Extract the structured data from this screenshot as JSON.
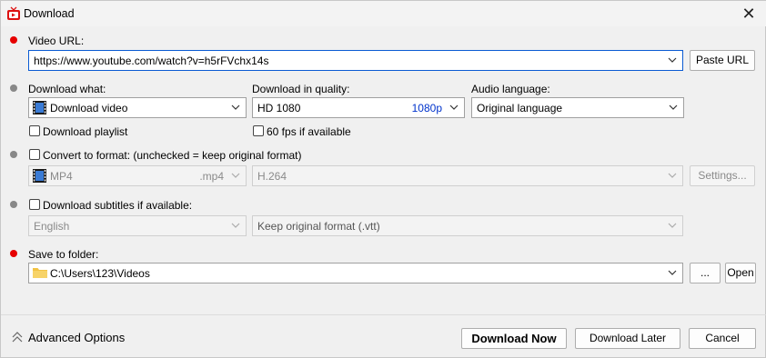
{
  "window": {
    "title": "Download"
  },
  "video_url": {
    "label": "Video URL:",
    "value": "https://www.youtube.com/watch?v=h5rFVchx14s",
    "paste_button": "Paste URL"
  },
  "download_what": {
    "label": "Download what:",
    "value": "Download video",
    "playlist_label": "Download playlist"
  },
  "quality": {
    "label": "Download in quality:",
    "value": "HD 1080",
    "badge": "1080p",
    "fps_label": "60 fps if available"
  },
  "audio": {
    "label": "Audio language:",
    "value": "Original language"
  },
  "convert": {
    "label": "Convert to format: (unchecked = keep original format)",
    "format": "MP4",
    "ext": ".mp4",
    "codec": "H.264",
    "settings_button": "Settings..."
  },
  "subtitles": {
    "label": "Download subtitles if available:",
    "language": "English",
    "format": "Keep original format (.vtt)"
  },
  "folder": {
    "label": "Save to folder:",
    "path": "C:\\Users\\123\\Videos",
    "browse_button": "...",
    "open_button": "Open"
  },
  "footer": {
    "advanced": "Advanced Options",
    "download_now": "Download Now",
    "download_later": "Download Later",
    "cancel": "Cancel"
  },
  "colors": {
    "accent": "#0a5bd3",
    "required_dot": "#e60000",
    "optional_dot": "#888888",
    "quality_badge": "#0033cc"
  }
}
